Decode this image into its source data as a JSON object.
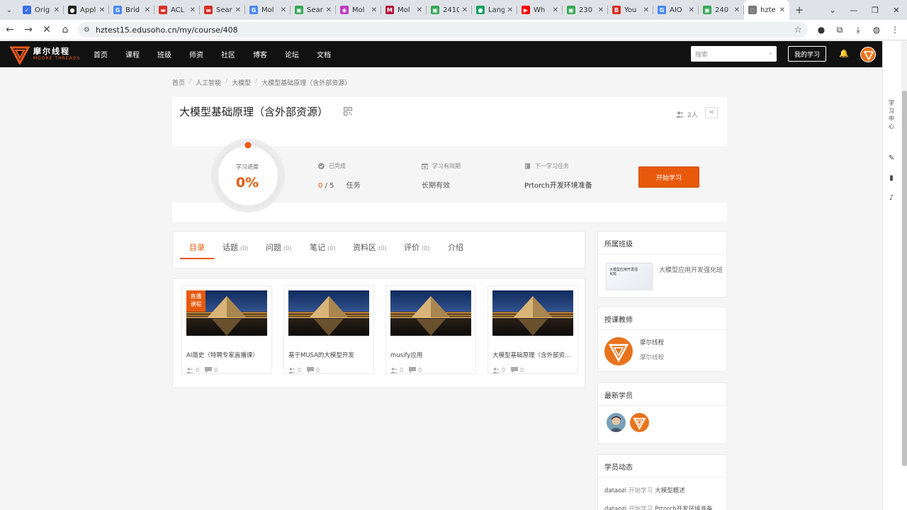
{
  "browser": {
    "tabs": [
      {
        "title": "Orig",
        "color": "#3b6ee8",
        "glyph": "✓"
      },
      {
        "title": "Appl",
        "color": "#222222",
        "glyph": "●"
      },
      {
        "title": "Brid",
        "color": "#4a89f3",
        "glyph": "G"
      },
      {
        "title": "ACL",
        "color": "#d93025",
        "glyph": "▬"
      },
      {
        "title": "Sear",
        "color": "#d93025",
        "glyph": "▬"
      },
      {
        "title": "Mol",
        "color": "#4a89f3",
        "glyph": "G"
      },
      {
        "title": "Sear",
        "color": "#34a853",
        "glyph": "▣"
      },
      {
        "title": "Mol",
        "color": "#c03ec3",
        "glyph": "◆"
      },
      {
        "title": "Mol",
        "color": "#b3123a",
        "glyph": "M"
      },
      {
        "title": "2410",
        "color": "#34a853",
        "glyph": "▣"
      },
      {
        "title": "Lang",
        "color": "#1aa260",
        "glyph": "●"
      },
      {
        "title": "Wh",
        "color": "#ff0000",
        "glyph": "▶"
      },
      {
        "title": "230",
        "color": "#34a853",
        "glyph": "▣"
      },
      {
        "title": "You",
        "color": "#d93025",
        "glyph": "B"
      },
      {
        "title": "AIO",
        "color": "#4a89f3",
        "glyph": "G"
      },
      {
        "title": "240",
        "color": "#34a853",
        "glyph": "▣"
      },
      {
        "title": "hzte",
        "color": "#777777",
        "glyph": "◌"
      }
    ],
    "url": "hztest15.edusoho.cn/my/course/408"
  },
  "header": {
    "logo_cn": "摩尔线程",
    "logo_en": "MOORE THREADS",
    "nav": [
      "首页",
      "课程",
      "班级",
      "师资",
      "社区",
      "博客",
      "论坛",
      "文档"
    ],
    "search_placeholder": "搜索",
    "my_learning": "我的学习"
  },
  "right_sidebar": {
    "labels": [
      "学",
      "习",
      "中",
      "心"
    ]
  },
  "breadcrumb": [
    "首页",
    "人工智能",
    "大模型",
    "大模型基础原理（含外部资源）"
  ],
  "course": {
    "title": "大模型基础原理（含外部资源）",
    "members": "2人",
    "progress_label": "学习进度",
    "progress_value": "0%",
    "progress": 0,
    "completed_label": "已完成",
    "completed_done": "0",
    "completed_total": "/ 5",
    "completed_unit": "任务",
    "validity_label": "学习有效期",
    "validity_value": "长期有效",
    "next_label": "下一学习任务",
    "next_value": "Prtorch开发环境准备",
    "start_button": "开始学习",
    "accent": "#e8590c"
  },
  "tabs": [
    {
      "label": "目录",
      "count": ""
    },
    {
      "label": "话题",
      "count": "(0)"
    },
    {
      "label": "问题",
      "count": "(0)"
    },
    {
      "label": "笔记",
      "count": "(0)"
    },
    {
      "label": "资料区",
      "count": "(0)"
    },
    {
      "label": "评价",
      "count": "(0)"
    },
    {
      "label": "介绍",
      "count": ""
    }
  ],
  "lessons": [
    {
      "title": "AI简史（特聘专家直播课）",
      "students": "0",
      "comments": "0",
      "badge": "直播课程"
    },
    {
      "title": "基于MUSA的大模型开发",
      "students": "0",
      "comments": "0",
      "badge": ""
    },
    {
      "title": "musify应用",
      "students": "0",
      "comments": "0",
      "badge": ""
    },
    {
      "title": "大模型基础原理（含外部资源）",
      "students": "0",
      "comments": "0",
      "badge": ""
    }
  ],
  "side": {
    "class_title": "所属班级",
    "class_thumb_text": "大模型应用开发强化班",
    "class_name": "大模型应用开发强化班",
    "teacher_title": "授课教师",
    "teacher_name": "摩尔线程",
    "teacher_org": "摩尔线程",
    "students_title": "最新学员",
    "activity_title": "学员动态",
    "activities": [
      {
        "user": "dataozi",
        "verb": "开始学习",
        "target": "大模型概述"
      },
      {
        "user": "dataozi",
        "verb": "开始学习",
        "target": "Prtorch开发环境准备"
      }
    ]
  }
}
